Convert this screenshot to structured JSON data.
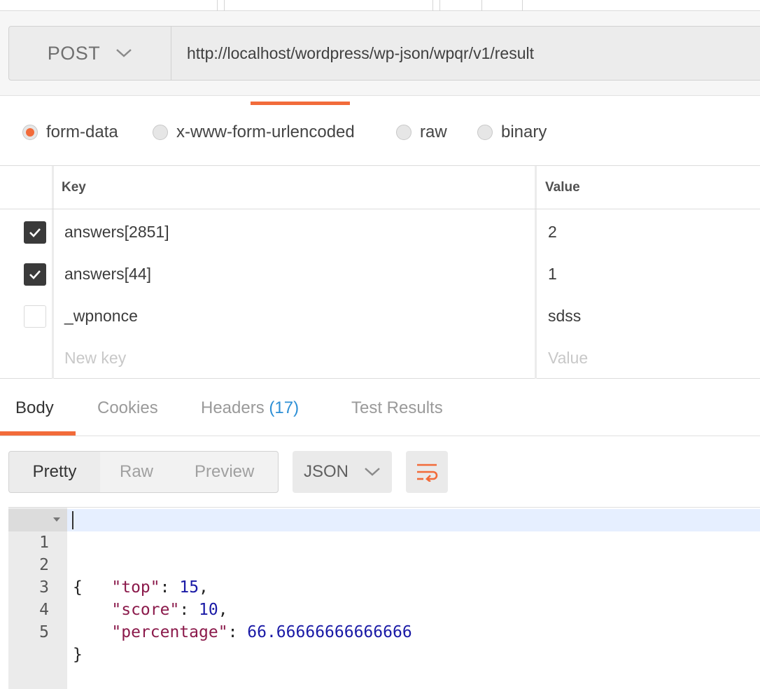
{
  "request": {
    "method": "POST",
    "url": "http://localhost/wordpress/wp-json/wpqr/v1/result"
  },
  "body_types": [
    {
      "label": "form-data",
      "selected": true
    },
    {
      "label": "x-www-form-urlencoded",
      "selected": false
    },
    {
      "label": "raw",
      "selected": false
    },
    {
      "label": "binary",
      "selected": false
    }
  ],
  "params": {
    "headers": {
      "key": "Key",
      "value": "Value"
    },
    "rows": [
      {
        "key": "answers[2851]",
        "value": "2",
        "enabled": true
      },
      {
        "key": "answers[44]",
        "value": "1",
        "enabled": true
      },
      {
        "key": "_wpnonce",
        "value": "sdss",
        "enabled": false
      }
    ],
    "new_row": {
      "key_placeholder": "New key",
      "value_placeholder": "Value"
    }
  },
  "response": {
    "tabs": {
      "body": "Body",
      "cookies": "Cookies",
      "headers": "Headers",
      "headers_count": "(17)",
      "tests": "Test Results"
    },
    "views": {
      "pretty": "Pretty",
      "raw": "Raw",
      "preview": "Preview"
    },
    "format": "JSON",
    "lines": [
      {
        "n": "1",
        "open": "{"
      },
      {
        "n": "2",
        "key": "\"top\"",
        "value": "15"
      },
      {
        "n": "3",
        "key": "\"score\"",
        "value": "10"
      },
      {
        "n": "4",
        "key": "\"percentage\"",
        "value": "66.66666666666666"
      },
      {
        "n": "5",
        "close": "}"
      }
    ]
  },
  "colors": {
    "accent": "#f26b3a",
    "link_blue": "#2d8fd5",
    "json_key": "#8b1a4b",
    "json_number": "#1a1aa6"
  },
  "icons": {
    "method_dropdown": "chevron-down-icon",
    "format_dropdown": "chevron-down-icon",
    "wrap": "wrap-lines-icon",
    "check": "checkmark-icon",
    "fold": "fold-triangle-icon"
  }
}
